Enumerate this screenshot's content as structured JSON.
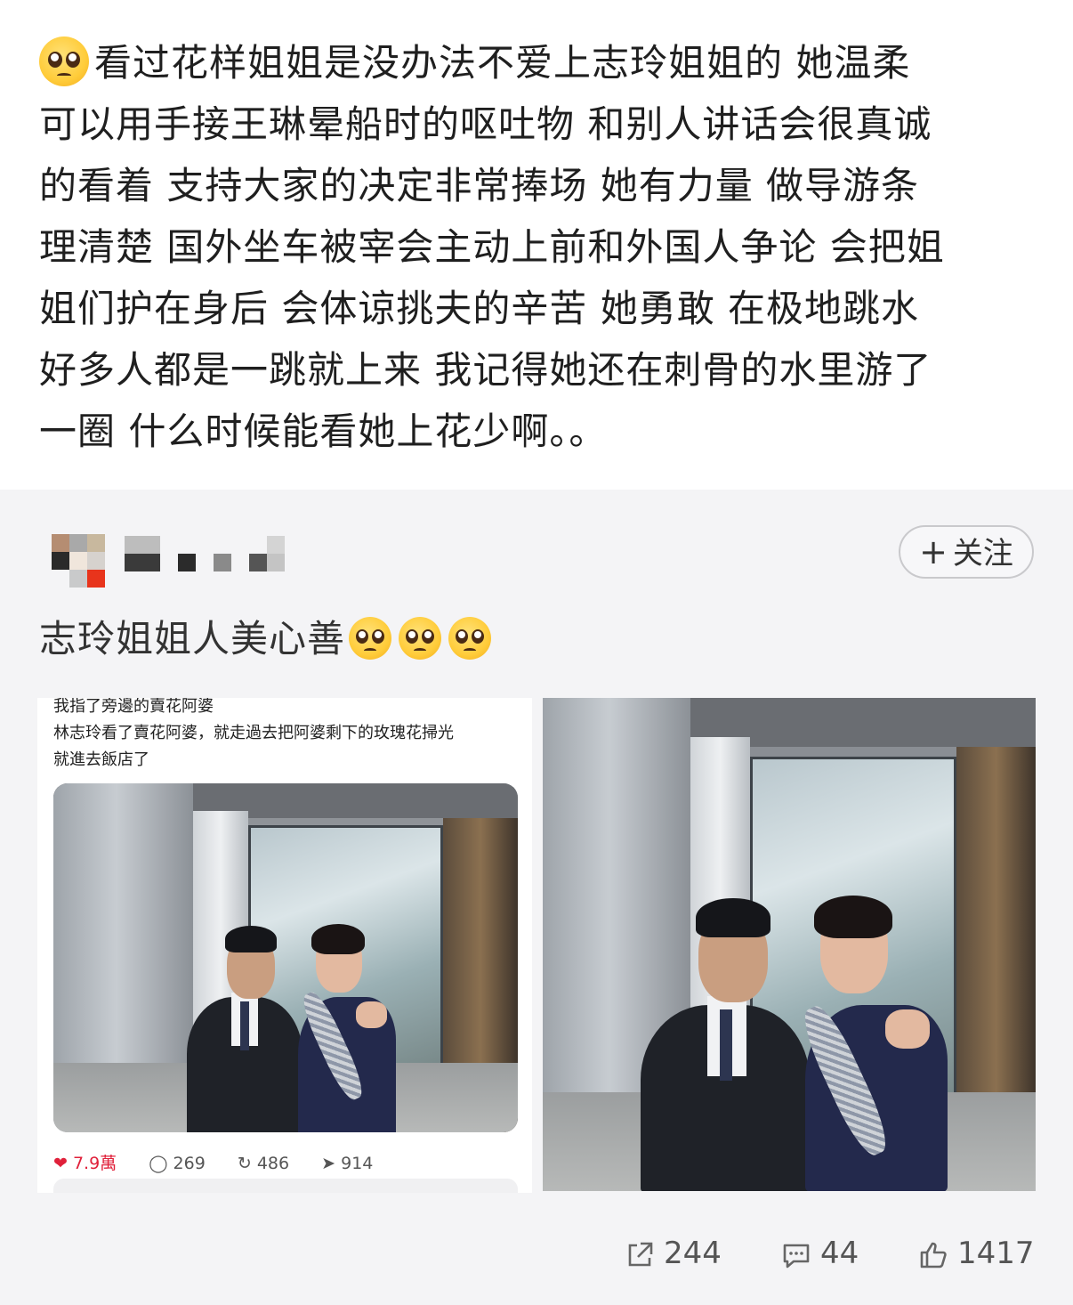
{
  "post": {
    "lines": [
      "看过花样姐姐是没办法不爱上志玲姐姐的 她温柔",
      "可以用手接王琳晕船时的呕吐物 和别人讲话会很真诚",
      "的看着 支持大家的决定非常捧场 她有力量 做导游条",
      "理清楚 国外坐车被宰会主动上前和外国人争论 会把姐",
      "姐们护在身后 会体谅挑夫的辛苦 她勇敢 在极地跳水",
      "好多人都是一跳就上来 我记得她还在刺骨的水里游了",
      "一圈 什么时候能看她上花少啊。。"
    ],
    "emoji": "pleading-face"
  },
  "repost": {
    "follow_label": "关注",
    "follow_plus": "+",
    "text": "志玲姐姐人美心善",
    "emoji_count": 3,
    "screenshot": {
      "caption_lines": [
        "我指了旁邊的賣花阿婆",
        "林志玲看了賣花阿婆，就走過去把阿婆剩下的玫瑰花掃光",
        "就進去飯店了"
      ],
      "likes": "7.9萬",
      "comments": "269",
      "reposts": "486",
      "shares": "914"
    }
  },
  "actions": {
    "share_count": "244",
    "comment_count": "44",
    "like_count": "1417"
  },
  "colors": {
    "background": "#ffffff",
    "repost_bg": "#f4f4f6",
    "heart": "#e0203a",
    "text": "#1f1f1f"
  }
}
